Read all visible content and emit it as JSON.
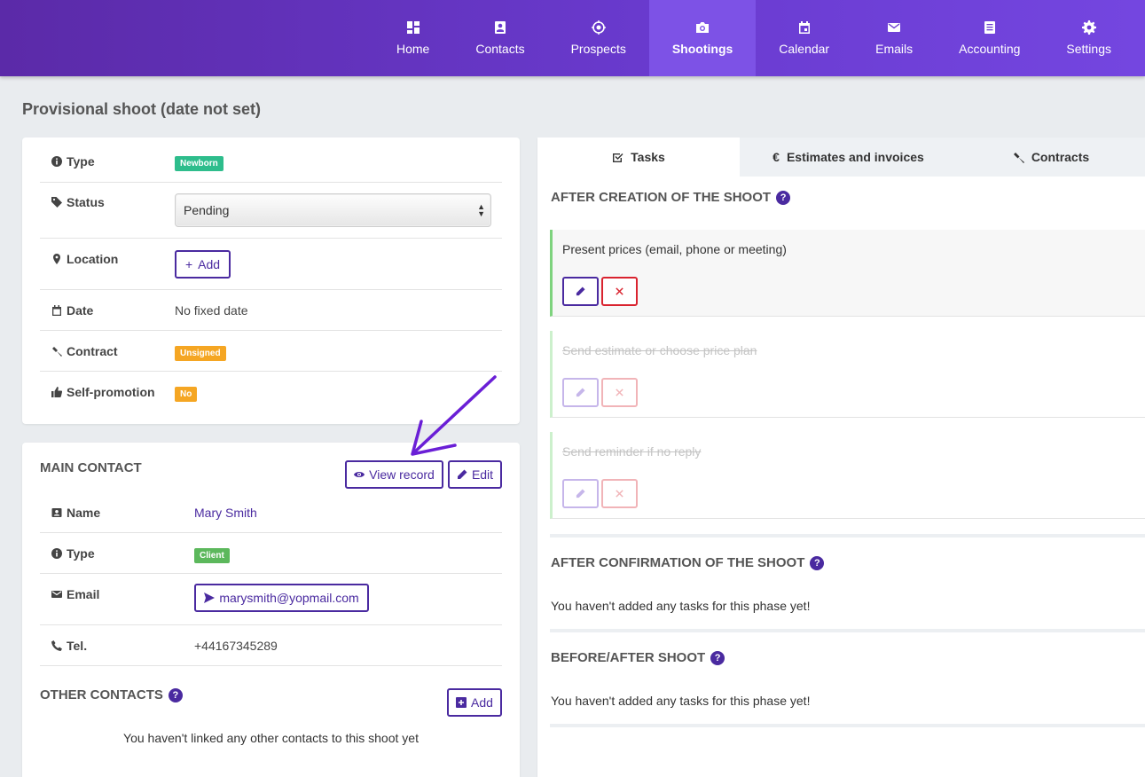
{
  "nav": [
    {
      "label": "Home",
      "icon": "dashboard-icon"
    },
    {
      "label": "Contacts",
      "icon": "contacts-icon"
    },
    {
      "label": "Prospects",
      "icon": "target-icon"
    },
    {
      "label": "Shootings",
      "icon": "camera-icon",
      "active": true
    },
    {
      "label": "Calendar",
      "icon": "calendar-icon"
    },
    {
      "label": "Emails",
      "icon": "envelope-icon"
    },
    {
      "label": "Accounting",
      "icon": "ledger-icon"
    },
    {
      "label": "Settings",
      "icon": "gear-icon"
    }
  ],
  "page_title": "Provisional shoot (date not set)",
  "details": {
    "type_label": "Type",
    "type_value": "Newborn",
    "status_label": "Status",
    "status_value": "Pending",
    "location_label": "Location",
    "location_add": "Add",
    "date_label": "Date",
    "date_value": "No fixed date",
    "contract_label": "Contract",
    "contract_value": "Unsigned",
    "selfpromo_label": "Self-promotion",
    "selfpromo_value": "No"
  },
  "main_contact": {
    "heading": "MAIN CONTACT",
    "view_record": "View record",
    "edit": "Edit",
    "name_label": "Name",
    "name_value": "Mary Smith",
    "type_label": "Type",
    "type_value": "Client",
    "email_label": "Email",
    "email_value": "marysmith@yopmail.com",
    "tel_label": "Tel.",
    "tel_value": "+44167345289"
  },
  "other_contacts": {
    "heading": "OTHER CONTACTS",
    "add": "Add",
    "empty": "You haven't linked any other contacts to this shoot yet"
  },
  "tabs": [
    {
      "label": "Tasks",
      "icon": "checkbox-icon",
      "active": true
    },
    {
      "label": "Estimates and invoices",
      "icon": "euro-icon"
    },
    {
      "label": "Contracts",
      "icon": "gavel-icon"
    }
  ],
  "phases": {
    "creation": {
      "heading": "AFTER CREATION OF THE SHOOT",
      "tasks": [
        {
          "title": "Present prices (email, phone or meeting)",
          "done": false
        },
        {
          "title": "Send estimate or choose price plan",
          "done": true
        },
        {
          "title": "Send reminder if no reply",
          "done": true
        }
      ]
    },
    "confirmation": {
      "heading": "AFTER CONFIRMATION OF THE SHOOT",
      "empty": "You haven't added any tasks for this phase yet!"
    },
    "beforeafter": {
      "heading": "BEFORE/AFTER SHOOT",
      "empty": "You haven't added any tasks for this phase yet!"
    }
  },
  "colors": {
    "brand": "#5b2aa8",
    "accent": "#4a2aa0",
    "danger": "#d9232f",
    "success": "#7ed37e",
    "annotation_arrow": "#6a1fd6"
  }
}
